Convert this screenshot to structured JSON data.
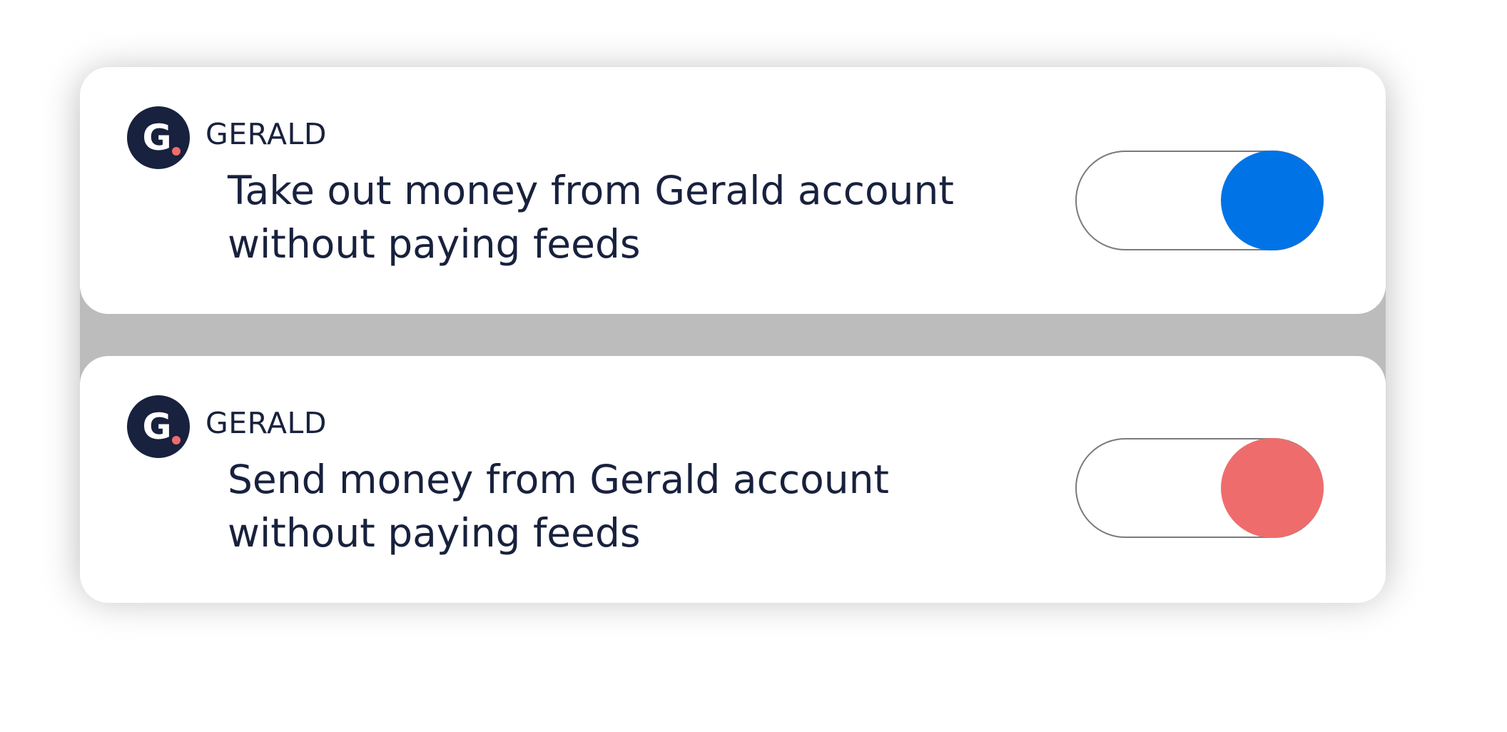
{
  "notifications": [
    {
      "brand": "GERALD",
      "logo_letter": "G",
      "message": "Take out money from Gerald account\nwithout paying feeds",
      "toggle_color": "#0073e6"
    },
    {
      "brand": "GERALD",
      "logo_letter": "G",
      "message": "Send money from Gerald account\nwithout paying feeds",
      "toggle_color": "#ef6c6c"
    }
  ],
  "colors": {
    "text": "#18213d",
    "logo_bg": "#18213d",
    "logo_dot": "#ef6c6c",
    "shadow": "#bcbcbc"
  }
}
